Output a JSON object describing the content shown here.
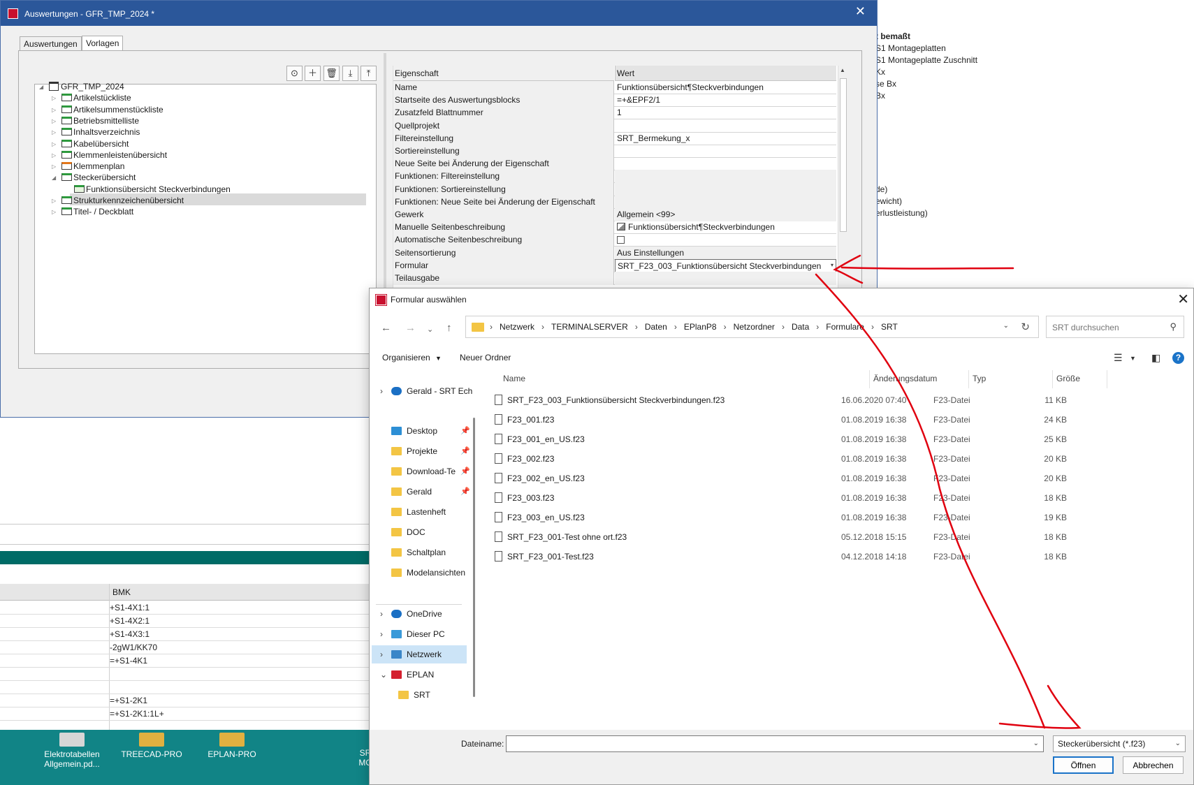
{
  "background": {
    "right_text": [
      {
        "text": "t bemaßt",
        "bold": true
      },
      {
        "text": "S1 Montageplatten",
        "bold": false
      },
      {
        "text": "S1 Montageplatte Zuschnitt",
        "bold": false
      },
      {
        "text": " Kx",
        "bold": false
      },
      {
        "text": "se Bx",
        "bold": false
      },
      {
        "text": "Bx",
        "bold": false
      }
    ],
    "right_text2": [
      "de)",
      "ewicht)",
      "erlustleistung)"
    ],
    "table": {
      "header": "BMK",
      "rows": [
        "+S1-4X1:1",
        "+S1-4X2:1",
        "+S1-4X3:1",
        "-2gW1/KK70",
        "=+S1-4K1",
        "",
        "",
        "=+S1-2K1",
        "=+S1-2K1:1L+"
      ]
    },
    "desktop_icons": [
      {
        "label": "Elektrotabellen Allgemein.pd...",
        "icon": "pdf-shortcut-icon"
      },
      {
        "label": "TREECAD-PRO",
        "icon": "folder-shortcut-icon"
      },
      {
        "label": "EPLAN-PRO",
        "icon": "folder-shortcut-icon"
      },
      {
        "label": "SR MO",
        "icon": "folder-shortcut-icon"
      }
    ]
  },
  "main_window": {
    "title": "Auswertungen - GFR_TMP_2024 *",
    "tabs": [
      {
        "label": "Auswertungen",
        "active": false
      },
      {
        "label": "Vorlagen",
        "active": true
      }
    ],
    "toolbar_icons": [
      "run-icon",
      "add-icon",
      "delete-icon",
      "import-icon",
      "export-icon"
    ],
    "tree": {
      "root": "GFR_TMP_2024",
      "items": [
        {
          "label": "Artikelstückliste",
          "folder": "green",
          "expanded": false
        },
        {
          "label": "Artikelsummenstückliste",
          "folder": "green",
          "expanded": false
        },
        {
          "label": "Betriebsmittelliste",
          "folder": "green",
          "expanded": false
        },
        {
          "label": "Inhaltsverzeichnis",
          "folder": "green",
          "expanded": false
        },
        {
          "label": "Kabelübersicht",
          "folder": "green",
          "expanded": false
        },
        {
          "label": "Klemmenleistenübersicht",
          "folder": "green",
          "expanded": false
        },
        {
          "label": "Klemmenplan",
          "folder": "orange",
          "expanded": false
        },
        {
          "label": "Steckerübersicht",
          "folder": "green",
          "expanded": true
        },
        {
          "label": "Funktionsübersicht Steckverbindungen",
          "folder": "green-open",
          "child": true,
          "selected": true
        },
        {
          "label": "Strukturkennzeichenübersicht",
          "folder": "green",
          "expanded": false
        },
        {
          "label": "Titel- / Deckblatt",
          "folder": "green",
          "expanded": false
        }
      ]
    },
    "properties": {
      "header_key": "Eigenschaft",
      "header_value": "Wert",
      "rows": [
        {
          "key": "Name",
          "value": "Funktionsübersicht¶Steckverbindungen",
          "type": "text"
        },
        {
          "key": "Startseite des Auswertungsblocks",
          "value": "=+&EPF2/1",
          "type": "text"
        },
        {
          "key": "Zusatzfeld Blattnummer",
          "value": "1",
          "type": "text"
        },
        {
          "key": "Quellprojekt",
          "value": "",
          "type": "text"
        },
        {
          "key": "Filtereinstellung",
          "value": "SRT_Bermekung_x",
          "type": "text"
        },
        {
          "key": "Sortiereinstellung",
          "value": "",
          "type": "text"
        },
        {
          "key": "Neue Seite bei Änderung der Eigenschaft",
          "value": "",
          "type": "text"
        },
        {
          "key": "Funktionen: Filtereinstellung",
          "value": "",
          "type": "gray"
        },
        {
          "key": "Funktionen: Sortiereinstellung",
          "value": "",
          "type": "gray"
        },
        {
          "key": "Funktionen: Neue Seite bei Änderung der Eigenschaft",
          "value": "",
          "type": "gray"
        },
        {
          "key": "Gewerk",
          "value": "Allgemein <99>",
          "type": "gray"
        },
        {
          "key": "Manuelle Seitenbeschreibung",
          "value": "Funktionsübersicht¶Steckverbindungen",
          "type": "icon"
        },
        {
          "key": "Automatische Seitenbeschreibung",
          "value": "",
          "type": "checkbox"
        },
        {
          "key": "Seitensortierung",
          "value": "Aus Einstellungen",
          "type": "gray"
        },
        {
          "key": "Formular",
          "value": "SRT_F23_003_Funktionsübersicht Steckverbindungen",
          "type": "combo"
        },
        {
          "key": "Teilausgabe",
          "value": "",
          "type": "gray"
        }
      ]
    }
  },
  "dialog": {
    "title": "Formular auswählen",
    "nav_icons": [
      "back-icon",
      "forward-icon",
      "recent-icon",
      "up-icon"
    ],
    "breadcrumb": [
      "Netzwerk",
      "TERMINALSERVER",
      "Daten",
      "EPlanP8",
      "Netzordner",
      "Data",
      "Formulare",
      "SRT"
    ],
    "search_placeholder": "SRT durchsuchen",
    "toolbar": {
      "organize": "Organisieren",
      "new_folder": "Neuer Ordner"
    },
    "nav_items": [
      {
        "label": "Gerald - SRT Ech",
        "icon": "cloud-blue",
        "chevron": ">",
        "pin": false,
        "selected": false
      },
      {
        "label": "Desktop",
        "icon": "desktop",
        "chevron": "",
        "pin": true,
        "selected": false
      },
      {
        "label": "Projekte",
        "icon": "folder",
        "chevron": "",
        "pin": true,
        "selected": false
      },
      {
        "label": "Download-Te",
        "icon": "folder",
        "chevron": "",
        "pin": true,
        "selected": false
      },
      {
        "label": "Gerald",
        "icon": "folder",
        "chevron": "",
        "pin": true,
        "selected": false
      },
      {
        "label": "Lastenheft",
        "icon": "folder",
        "chevron": "",
        "pin": false,
        "selected": false
      },
      {
        "label": "DOC",
        "icon": "folder",
        "chevron": "",
        "pin": false,
        "selected": false
      },
      {
        "label": "Schaltplan",
        "icon": "folder",
        "chevron": "",
        "pin": false,
        "selected": false
      },
      {
        "label": "Modelansichten",
        "icon": "folder",
        "chevron": "",
        "pin": false,
        "selected": false
      },
      {
        "label": "OneDrive",
        "icon": "cloud-blue",
        "chevron": ">",
        "pin": false,
        "selected": false
      },
      {
        "label": "Dieser PC",
        "icon": "pc",
        "chevron": ">",
        "pin": false,
        "selected": false
      },
      {
        "label": "Netzwerk",
        "icon": "network",
        "chevron": ">",
        "pin": false,
        "selected": true
      },
      {
        "label": "EPLAN",
        "icon": "eplan",
        "chevron": "v",
        "pin": false,
        "selected": false
      },
      {
        "label": "SRT",
        "icon": "folder",
        "chevron": "",
        "pin": false,
        "selected": false
      }
    ],
    "columns": {
      "name": "Name",
      "date": "Änderungsdatum",
      "type": "Typ",
      "size": "Größe"
    },
    "files": [
      {
        "name": "SRT_F23_003_Funktionsübersicht Steckverbindungen.f23",
        "date": "16.06.2020 07:40",
        "type": "F23-Datei",
        "size": "11 KB"
      },
      {
        "name": "F23_001.f23",
        "date": "01.08.2019 16:38",
        "type": "F23-Datei",
        "size": "24 KB"
      },
      {
        "name": "F23_001_en_US.f23",
        "date": "01.08.2019 16:38",
        "type": "F23-Datei",
        "size": "25 KB"
      },
      {
        "name": "F23_002.f23",
        "date": "01.08.2019 16:38",
        "type": "F23-Datei",
        "size": "20 KB"
      },
      {
        "name": "F23_002_en_US.f23",
        "date": "01.08.2019 16:38",
        "type": "F23-Datei",
        "size": "20 KB"
      },
      {
        "name": "F23_003.f23",
        "date": "01.08.2019 16:38",
        "type": "F23-Datei",
        "size": "18 KB"
      },
      {
        "name": "F23_003_en_US.f23",
        "date": "01.08.2019 16:38",
        "type": "F23-Datei",
        "size": "19 KB"
      },
      {
        "name": "SRT_F23_001-Test ohne ort.f23",
        "date": "05.12.2018 15:15",
        "type": "F23-Datei",
        "size": "18 KB"
      },
      {
        "name": "SRT_F23_001-Test.f23",
        "date": "04.12.2018 14:18",
        "type": "F23-Datei",
        "size": "18 KB"
      }
    ],
    "filename_label": "Dateiname:",
    "filename_value": "",
    "filetype": "Steckerübersicht (*.f23)",
    "open_button": "Öffnen",
    "cancel_button": "Abbrechen"
  },
  "colors": {
    "title_blue": "#2b579a",
    "annotation_red": "#e0000f",
    "desktop_teal": "#118486",
    "selection": "#cce4f7"
  }
}
